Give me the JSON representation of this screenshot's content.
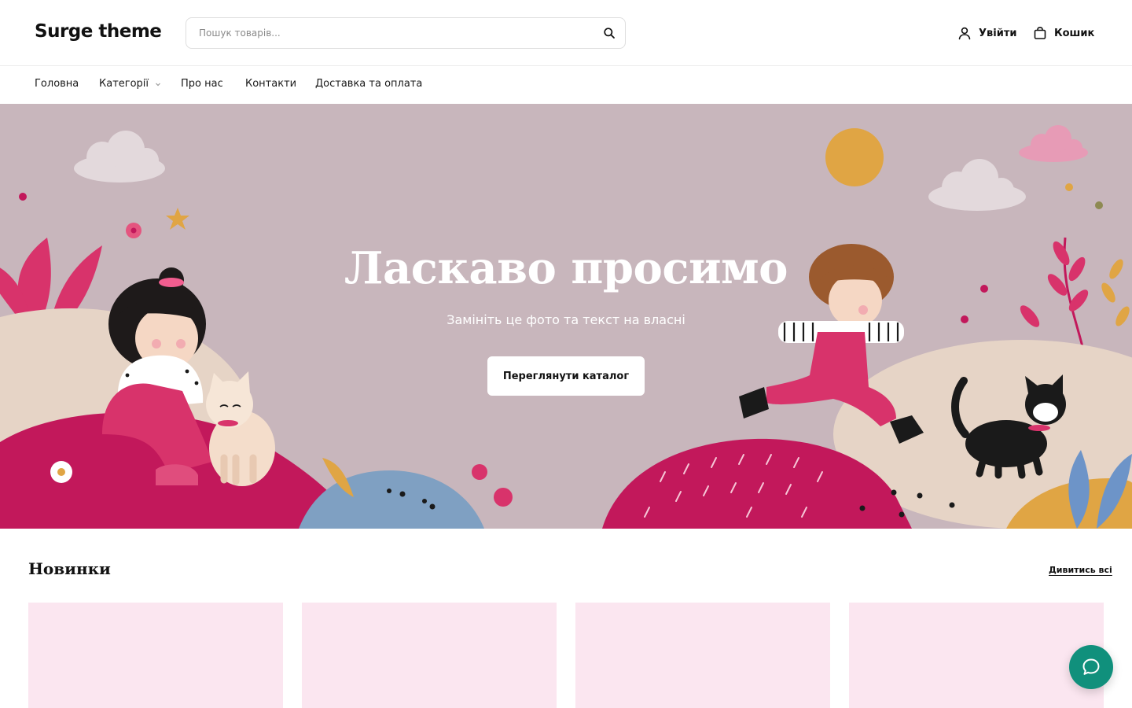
{
  "header": {
    "logo": "Surge theme",
    "search_placeholder": "Пошук товарів...",
    "login_label": "Увійти",
    "cart_label": "Кошик"
  },
  "nav": {
    "items": [
      {
        "label": "Головна",
        "has_dropdown": false
      },
      {
        "label": "Категорії",
        "has_dropdown": true
      },
      {
        "label": "Про нас",
        "has_dropdown": false
      },
      {
        "label": "Контакти",
        "has_dropdown": false
      },
      {
        "label": "Доставка та оплата",
        "has_dropdown": false
      }
    ]
  },
  "hero": {
    "title": "Ласкаво просимо",
    "subtitle": "Замініть це фото та текст на власні",
    "cta_label": "Переглянути каталог"
  },
  "new_arrivals": {
    "title": "Новинки",
    "view_all_label": "Дивитись всі",
    "card_count": 4
  },
  "icons": {
    "search": "search-icon",
    "login": "user-icon",
    "cart": "shopping-bag-icon",
    "dropdown": "chevron-down-icon",
    "chat": "chat-bubble-icon"
  },
  "colors": {
    "hero_bg": "#c8b6bc",
    "card_placeholder": "#fbe6f0",
    "chat_button": "#10907c",
    "accent_pink": "#c2185b"
  }
}
